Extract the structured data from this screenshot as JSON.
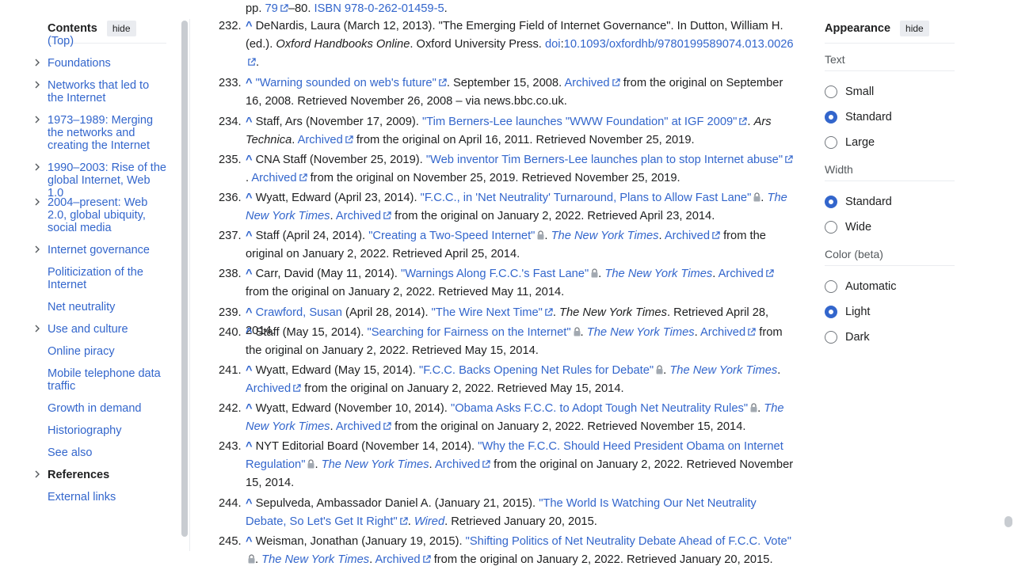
{
  "toc": {
    "title": "Contents",
    "hide_label": "hide",
    "items": [
      {
        "label": "(Top)",
        "expandable": false,
        "active": false
      },
      {
        "label": "Foundations",
        "expandable": true,
        "active": false
      },
      {
        "label": "Networks that led to the Internet",
        "expandable": true,
        "active": false
      },
      {
        "label": "1973–1989: Merging the networks and creating the Internet",
        "expandable": true,
        "active": false
      },
      {
        "label": "1990–2003: Rise of the global Internet, Web 1.0",
        "expandable": true,
        "active": false
      },
      {
        "label": "2004–present: Web 2.0, global ubiquity, social media",
        "expandable": true,
        "active": false
      },
      {
        "label": "Internet governance",
        "expandable": true,
        "active": false
      },
      {
        "label": "Politicization of the Internet",
        "expandable": false,
        "active": false
      },
      {
        "label": "Net neutrality",
        "expandable": false,
        "active": false
      },
      {
        "label": "Use and culture",
        "expandable": true,
        "active": false
      },
      {
        "label": "Online piracy",
        "expandable": false,
        "active": false
      },
      {
        "label": "Mobile telephone data traffic",
        "expandable": false,
        "active": false
      },
      {
        "label": "Growth in demand",
        "expandable": false,
        "active": false
      },
      {
        "label": "Historiography",
        "expandable": false,
        "active": false
      },
      {
        "label": "See also",
        "expandable": false,
        "active": false
      },
      {
        "label": "References",
        "expandable": true,
        "active": true
      },
      {
        "label": "External links",
        "expandable": false,
        "active": false
      }
    ]
  },
  "references": {
    "top_fragment": {
      "pp": "pp. ",
      "page_link": "79",
      "rest": "–80. ",
      "isbn": "ISBN 978-0-262-01459-5",
      "end": "."
    },
    "items": [
      {
        "num": "232.",
        "segs": [
          {
            "t": "DeNardis, Laura (March 12, 2013). \"The Emerging Field of Internet Governance\". In Dutton, William H. (ed.). "
          },
          {
            "t": "Oxford Handbooks Online",
            "i": true
          },
          {
            "t": ". Oxford University Press. "
          },
          {
            "t": "doi",
            "l": true
          },
          {
            "t": ":"
          },
          {
            "t": "10.1093/oxfordhb/9780199589074.013.0026",
            "l": true,
            "ext": true
          },
          {
            "t": "."
          }
        ]
      },
      {
        "num": "233.",
        "segs": [
          {
            "t": "\"Warning sounded on web's future\"",
            "l": true,
            "ext": true
          },
          {
            "t": ". September 15, 2008. "
          },
          {
            "t": "Archived",
            "l": true,
            "ext": true
          },
          {
            "t": " from the original on September 16, 2008. Retrieved November 26, 2008 – via news.bbc.co.uk."
          }
        ]
      },
      {
        "num": "234.",
        "segs": [
          {
            "t": "Staff, Ars (November 17, 2009). "
          },
          {
            "t": "\"Tim Berners-Lee launches \"WWW Foundation\" at IGF 2009\"",
            "l": true,
            "ext": true
          },
          {
            "t": ". "
          },
          {
            "t": "Ars Technica",
            "i": true
          },
          {
            "t": ". "
          },
          {
            "t": "Archived",
            "l": true,
            "ext": true
          },
          {
            "t": " from the original on April 16, 2011. Retrieved November 25, 2019."
          }
        ]
      },
      {
        "num": "235.",
        "segs": [
          {
            "t": "CNA Staff (November 25, 2019). "
          },
          {
            "t": "\"Web inventor Tim Berners-Lee launches plan to stop Internet abuse\"",
            "l": true,
            "ext": true
          },
          {
            "t": ". "
          },
          {
            "t": "Archived",
            "l": true,
            "ext": true
          },
          {
            "t": " from the original on November 25, 2019. Retrieved November 25, 2019."
          }
        ]
      },
      {
        "num": "236.",
        "segs": [
          {
            "t": "Wyatt, Edward (April 23, 2014). "
          },
          {
            "t": "\"F.C.C., in 'Net Neutrality' Turnaround, Plans to Allow Fast Lane\"",
            "l": true,
            "lock": true
          },
          {
            "t": ". "
          },
          {
            "t": "The New York Times",
            "i": true,
            "l": true
          },
          {
            "t": ". "
          },
          {
            "t": "Archived",
            "l": true,
            "ext": true
          },
          {
            "t": " from the original on January 2, 2022. Retrieved April 23, 2014."
          }
        ]
      },
      {
        "num": "237.",
        "segs": [
          {
            "t": "Staff (April 24, 2014). "
          },
          {
            "t": "\"Creating a Two-Speed Internet\"",
            "l": true,
            "lock": true
          },
          {
            "t": ". "
          },
          {
            "t": "The New York Times",
            "i": true,
            "l": true
          },
          {
            "t": ". "
          },
          {
            "t": "Archived",
            "l": true,
            "ext": true
          },
          {
            "t": " from the original on January 2, 2022. Retrieved April 25, 2014."
          }
        ]
      },
      {
        "num": "238.",
        "segs": [
          {
            "t": "Carr, David (May 11, 2014). "
          },
          {
            "t": "\"Warnings Along F.C.C.'s Fast Lane\"",
            "l": true,
            "lock": true
          },
          {
            "t": ". "
          },
          {
            "t": "The New York Times",
            "i": true,
            "l": true
          },
          {
            "t": ". "
          },
          {
            "t": "Archived",
            "l": true,
            "ext": true
          },
          {
            "t": " from the original on January 2, 2022. Retrieved May 11, 2014."
          }
        ]
      },
      {
        "num": "239.",
        "segs": [
          {
            "t": "Crawford, Susan",
            "l": true
          },
          {
            "t": " (April 28, 2014). "
          },
          {
            "t": "\"The Wire Next Time\"",
            "l": true,
            "ext": true
          },
          {
            "t": ". "
          },
          {
            "t": "The New York Times",
            "i": true
          },
          {
            "t": ". Retrieved April 28, 2014."
          }
        ]
      },
      {
        "num": "240.",
        "segs": [
          {
            "t": "Staff (May 15, 2014). "
          },
          {
            "t": "\"Searching for Fairness on the Internet\"",
            "l": true,
            "lock": true
          },
          {
            "t": ". "
          },
          {
            "t": "The New York Times",
            "i": true,
            "l": true
          },
          {
            "t": ". "
          },
          {
            "t": "Archived",
            "l": true,
            "ext": true
          },
          {
            "t": " from the original on January 2, 2022. Retrieved May 15, 2014."
          }
        ]
      },
      {
        "num": "241.",
        "segs": [
          {
            "t": "Wyatt, Edward (May 15, 2014). "
          },
          {
            "t": "\"F.C.C. Backs Opening Net Rules for Debate\"",
            "l": true,
            "lock": true
          },
          {
            "t": ". "
          },
          {
            "t": "The New York Times",
            "i": true,
            "l": true
          },
          {
            "t": ". "
          },
          {
            "t": "Archived",
            "l": true,
            "ext": true
          },
          {
            "t": " from the original on January 2, 2022. Retrieved May 15, 2014."
          }
        ]
      },
      {
        "num": "242.",
        "segs": [
          {
            "t": "Wyatt, Edward (November 10, 2014). "
          },
          {
            "t": "\"Obama Asks F.C.C. to Adopt Tough Net Neutrality Rules\"",
            "l": true,
            "lock": true
          },
          {
            "t": ". "
          },
          {
            "t": "The New York Times",
            "i": true,
            "l": true
          },
          {
            "t": ". "
          },
          {
            "t": "Archived",
            "l": true,
            "ext": true
          },
          {
            "t": " from the original on January 2, 2022. Retrieved November 15, 2014."
          }
        ]
      },
      {
        "num": "243.",
        "segs": [
          {
            "t": "NYT Editorial Board (November 14, 2014). "
          },
          {
            "t": "\"Why the F.C.C. Should Heed President Obama on Internet Regulation\"",
            "l": true,
            "lock": true
          },
          {
            "t": ". "
          },
          {
            "t": "The New York Times",
            "i": true,
            "l": true
          },
          {
            "t": ". "
          },
          {
            "t": "Archived",
            "l": true,
            "ext": true
          },
          {
            "t": " from the original on January 2, 2022. Retrieved November 15, 2014."
          }
        ]
      },
      {
        "num": "244.",
        "segs": [
          {
            "t": "Sepulveda, Ambassador Daniel A. (January 21, 2015). "
          },
          {
            "t": "\"The World Is Watching Our Net Neutrality Debate, So Let's Get It Right\"",
            "l": true,
            "ext": true
          },
          {
            "t": ". "
          },
          {
            "t": "Wired",
            "i": true,
            "l": true
          },
          {
            "t": ". Retrieved January 20, 2015."
          }
        ]
      },
      {
        "num": "245.",
        "segs": [
          {
            "t": "Weisman, Jonathan (January 19, 2015). "
          },
          {
            "t": "\"Shifting Politics of Net Neutrality Debate Ahead of F.C.C. Vote\"",
            "l": true,
            "lock": true
          },
          {
            "t": ". "
          },
          {
            "t": "The New York Times",
            "i": true,
            "l": true
          },
          {
            "t": ". "
          },
          {
            "t": "Archived",
            "l": true,
            "ext": true
          },
          {
            "t": " from the original on January 2, 2022. Retrieved January 20, 2015."
          }
        ]
      }
    ],
    "caret": "^"
  },
  "appearance": {
    "title": "Appearance",
    "hide_label": "hide",
    "sections": [
      {
        "label": "Text",
        "options": [
          {
            "label": "Small",
            "selected": false
          },
          {
            "label": "Standard",
            "selected": true
          },
          {
            "label": "Large",
            "selected": false
          }
        ]
      },
      {
        "label": "Width",
        "options": [
          {
            "label": "Standard",
            "selected": true
          },
          {
            "label": "Wide",
            "selected": false
          }
        ]
      },
      {
        "label": "Color (beta)",
        "options": [
          {
            "label": "Automatic",
            "selected": false
          },
          {
            "label": "Light",
            "selected": true
          },
          {
            "label": "Dark",
            "selected": false
          }
        ]
      }
    ]
  },
  "colors": {
    "link": "#3366cc",
    "text": "#202122",
    "radio_on": "#3366cc"
  }
}
